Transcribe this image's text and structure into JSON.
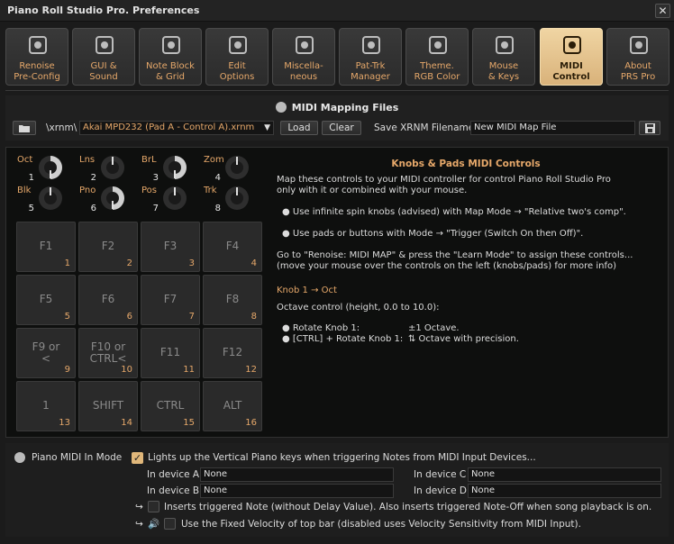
{
  "window": {
    "title": "Piano Roll Studio Pro.  Preferences",
    "close": "✕"
  },
  "tabs": [
    {
      "line1": "Renoise",
      "line2": "Pre-Config",
      "icon": "renoise-icon"
    },
    {
      "line1": "GUI &",
      "line2": "Sound",
      "icon": "gui-icon"
    },
    {
      "line1": "Note Block",
      "line2": "& Grid",
      "icon": "grid-icon"
    },
    {
      "line1": "Edit",
      "line2": "Options",
      "icon": "pencil-icon"
    },
    {
      "line1": "Miscella-",
      "line2": "neous",
      "icon": "tools-icon"
    },
    {
      "line1": "Pat-Trk",
      "line2": "Manager",
      "icon": "pattern-icon"
    },
    {
      "line1": "Theme.",
      "line2": "RGB Color",
      "icon": "palette-icon"
    },
    {
      "line1": "Mouse",
      "line2": "& Keys",
      "icon": "keys-icon"
    },
    {
      "line1": "MIDI",
      "line2": "Control",
      "icon": "midi-icon"
    },
    {
      "line1": "About",
      "line2": "PRS Pro",
      "icon": "question-icon"
    }
  ],
  "mapping": {
    "title": "MIDI Mapping Files",
    "path": "\\xrnm\\",
    "file": "Akai MPD232 (Pad A - Control A).xrnm",
    "load": "Load",
    "clear": "Clear",
    "save_label": "Save XRNM Filename",
    "save_value": "New MIDI Map File"
  },
  "knobs": [
    {
      "name": "Oct",
      "num": "1",
      "level": 0.5
    },
    {
      "name": "Lns",
      "num": "2",
      "level": 0.0
    },
    {
      "name": "BrL",
      "num": "3",
      "level": 0.5
    },
    {
      "name": "Zom",
      "num": "4",
      "level": 0.0
    },
    {
      "name": "Blk",
      "num": "5",
      "level": 0.0
    },
    {
      "name": "Pno",
      "num": "6",
      "level": 0.5
    },
    {
      "name": "Pos",
      "num": "7",
      "level": 0.0
    },
    {
      "name": "Trk",
      "num": "8",
      "level": 0.0
    }
  ],
  "pads": [
    {
      "label": "F1",
      "num": "1"
    },
    {
      "label": "F2",
      "num": "2"
    },
    {
      "label": "F3",
      "num": "3"
    },
    {
      "label": "F4",
      "num": "4"
    },
    {
      "label": "F5",
      "num": "5"
    },
    {
      "label": "F6",
      "num": "6"
    },
    {
      "label": "F7",
      "num": "7"
    },
    {
      "label": "F8",
      "num": "8"
    },
    {
      "label": "F9 or\n<",
      "num": "9"
    },
    {
      "label": "F10 or\nCTRL<",
      "num": "10"
    },
    {
      "label": "F11",
      "num": "11"
    },
    {
      "label": "F12",
      "num": "12"
    },
    {
      "label": "1",
      "num": "13"
    },
    {
      "label": "SHIFT",
      "num": "14"
    },
    {
      "label": "CTRL",
      "num": "15"
    },
    {
      "label": "ALT",
      "num": "16"
    }
  ],
  "info": {
    "title": "Knobs & Pads MIDI Controls",
    "p1a": "Map these controls to your MIDI controller for control Piano Roll Studio Pro",
    "p1b": "only with it or combined with your mouse.",
    "b1": "Use infinite spin knobs (advised) with Map Mode → \"Relative two's comp\".",
    "b2": "Use pads or buttons with Mode → \"Trigger (Switch On then Off)\".",
    "p2a": "Go to \"Renoise: MIDI MAP\" & press the \"Learn Mode\" to assign these controls...",
    "p2b": "(move your mouse over the controls on the left (knobs/pads) for more info)",
    "sel": "Knob 1 → Oct",
    "desc": "Octave control (height, 0.0 to 10.0):",
    "r1a": "Rotate Knob 1:",
    "r1b": "±1 Octave.",
    "r2a": "[CTRL] + Rotate Knob 1:",
    "r2b": "⇅ Octave with precision."
  },
  "bottom": {
    "mode_label": "Piano MIDI In Mode",
    "lights": "Lights up the Vertical Piano keys when triggering Notes from MIDI Input Devices...",
    "dev_a_label": "In device A",
    "dev_a": "None",
    "dev_b_label": "In device B",
    "dev_b": "None",
    "dev_c_label": "In device C",
    "dev_c": "None",
    "dev_d_label": "In device D",
    "dev_d": "None",
    "insert": "Inserts triggered Note (without Delay Value). Also inserts triggered Note-Off when song playback is on.",
    "velocity": "Use the Fixed Velocity of top bar (disabled uses Velocity Sensitivity from MIDI Input).",
    "arrow": "↪",
    "speaker": "🔊"
  },
  "colors": {
    "accent": "#e6a86a",
    "active_tab": "#e0b77a",
    "background": "#1b1b1b"
  }
}
